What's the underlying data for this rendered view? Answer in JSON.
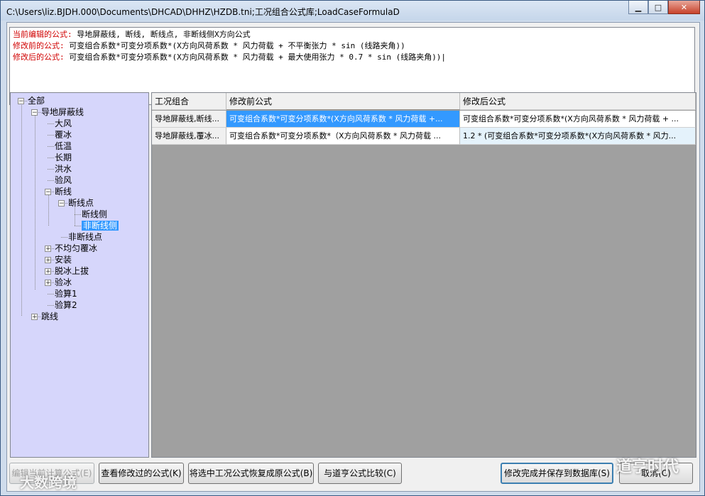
{
  "window": {
    "title": "C:\\Users\\liz.BJDH.000\\Documents\\DHCAD\\DHHZ\\HZDB.tni;工况组合公式库;LoadCaseFormulaD",
    "minimize_glyph": "▁",
    "maximize_glyph": "□",
    "close_glyph": "✕"
  },
  "editor": {
    "lines": [
      {
        "label": "当前编辑的公式:",
        "text": "导地屏蔽线, 断线, 断线点, 非断线侧X方向公式"
      },
      {
        "label": "修改前的公式:",
        "text": "可变组合系数*可变分项系数*(X方向风荷系数 * 风力荷载 + 不平衡张力 * sin (线路夹角))"
      },
      {
        "label": "修改后的公式:",
        "text": "可变组合系数*可变分项系数*(X方向风荷系数 * 风力荷载 + 最大使用张力 * 0.7 * sin (线路夹角))|"
      }
    ]
  },
  "tree": {
    "nodes": [
      {
        "label": "全部",
        "toggle": "⊟"
      },
      {
        "label": "导地屏蔽线",
        "toggle": "⊟"
      },
      {
        "label": "大风",
        "toggle": ""
      },
      {
        "label": "覆冰",
        "toggle": ""
      },
      {
        "label": "低温",
        "toggle": ""
      },
      {
        "label": "长期",
        "toggle": ""
      },
      {
        "label": "洪水",
        "toggle": ""
      },
      {
        "label": "验风",
        "toggle": ""
      },
      {
        "label": "断线",
        "toggle": "⊟"
      },
      {
        "label": "断线点",
        "toggle": "⊟"
      },
      {
        "label": "断线侧",
        "toggle": ""
      },
      {
        "label": "非断线侧",
        "toggle": "",
        "selected": true
      },
      {
        "label": "非断线点",
        "toggle": ""
      },
      {
        "label": "不均匀覆冰",
        "toggle": "⊞"
      },
      {
        "label": "安装",
        "toggle": "⊞"
      },
      {
        "label": "脱冰上拔",
        "toggle": "⊞"
      },
      {
        "label": "验冰",
        "toggle": "⊞"
      },
      {
        "label": "验算1",
        "toggle": ""
      },
      {
        "label": "验算2",
        "toggle": ""
      },
      {
        "label": "跳线",
        "toggle": "⊞"
      }
    ]
  },
  "grid": {
    "headers": [
      "工况组合",
      "修改前公式",
      "修改后公式"
    ],
    "rows": [
      [
        "导地屏蔽线,断线...",
        "可变组合系数*可变分项系数*(X方向风荷系数 * 风力荷载 +...",
        "可变组合系数*可变分项系数*(X方向风荷系数 * 风力荷载 + ..."
      ],
      [
        "导地屏蔽线,覆冰...",
        "可变组合系数*可变分项系数*（X方向风荷系数 * 风力荷载 ...",
        "1.2 * (可变组合系数*可变分项系数*(X方向风荷系数 * 风力..."
      ]
    ]
  },
  "buttons": {
    "edit_current": "编辑当前计算公式(E)",
    "view_modified": "查看修改过的公式(K)",
    "restore": "将选中工况公式恢复成原公式(B)",
    "compare": "与道亨公式比较(C)",
    "save": "修改完成并保存到数据库(S)",
    "cancel": "取消(C)"
  },
  "watermarks": {
    "bottom_left": "大数跨境",
    "bottom_right": "道亨时代"
  }
}
